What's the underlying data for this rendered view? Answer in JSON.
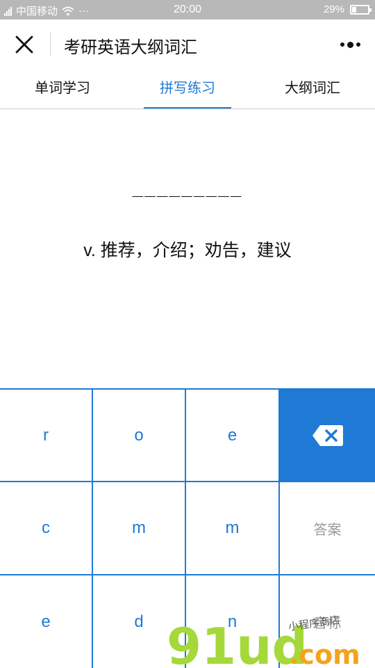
{
  "status_bar": {
    "carrier": "中国移动",
    "dots": "···",
    "time": "20:00",
    "battery": "29%",
    "battery_level": 0.29
  },
  "nav": {
    "title": "考研英语大纲词汇",
    "close_icon": "close-icon",
    "more_icon": "more-icon"
  },
  "tabs": [
    {
      "label": "单词学习",
      "active": false
    },
    {
      "label": "拼写练习",
      "active": true
    },
    {
      "label": "大纲词汇",
      "active": false
    }
  ],
  "quiz": {
    "blanks": "_________",
    "definition": "v. 推荐，介绍；劝告，建议"
  },
  "keyboard": {
    "letters": [
      "r",
      "o",
      "e",
      "c",
      "m",
      "m",
      "e",
      "d",
      "n"
    ],
    "delete_icon": "backspace-icon",
    "answer_label": "答案",
    "phonetic_label": "音标"
  },
  "watermark": {
    "brand": "91ud",
    "suffix": ".com",
    "tagline": "小程序商店"
  },
  "colors": {
    "accent": "#1e7ad4",
    "status_bar": "#b8b8b8",
    "watermark_green": "#a5d83a",
    "watermark_orange": "#f5a21c"
  }
}
